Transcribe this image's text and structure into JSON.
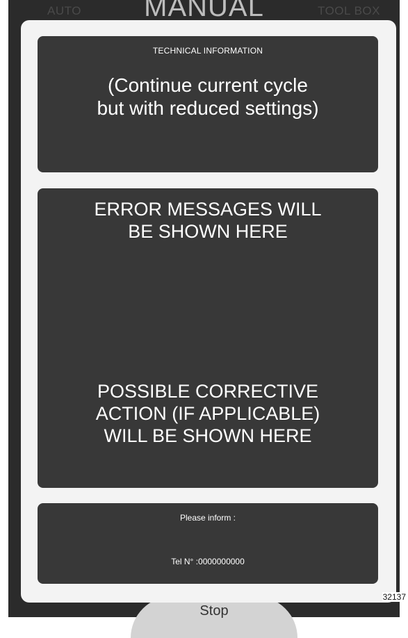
{
  "background": {
    "nav": {
      "left_label": "AUTO",
      "center_label": "MANUAL",
      "right_label": "TOOL BOX"
    },
    "stop_label": "Stop"
  },
  "dialog": {
    "info": {
      "heading": "TECHNICAL INFORMATION",
      "body_line1": "(Continue current cycle",
      "body_line2": "but with reduced settings)"
    },
    "error": {
      "message_line1": "ERROR MESSAGES WILL",
      "message_line2": "BE SHOWN HERE",
      "action_line1": "POSSIBLE CORRECTIVE",
      "action_line2": "ACTION (IF APPLICABLE)",
      "action_line3": "WILL BE SHOWN HERE"
    },
    "contact": {
      "prompt": "Please inform :",
      "tel_label": "Tel N° :",
      "tel_value": "0000000000"
    }
  },
  "reference_number": "32137",
  "colors": {
    "panel": "#383838",
    "modal": "#f3f3f3",
    "backdrop": "#2b2b2b"
  }
}
